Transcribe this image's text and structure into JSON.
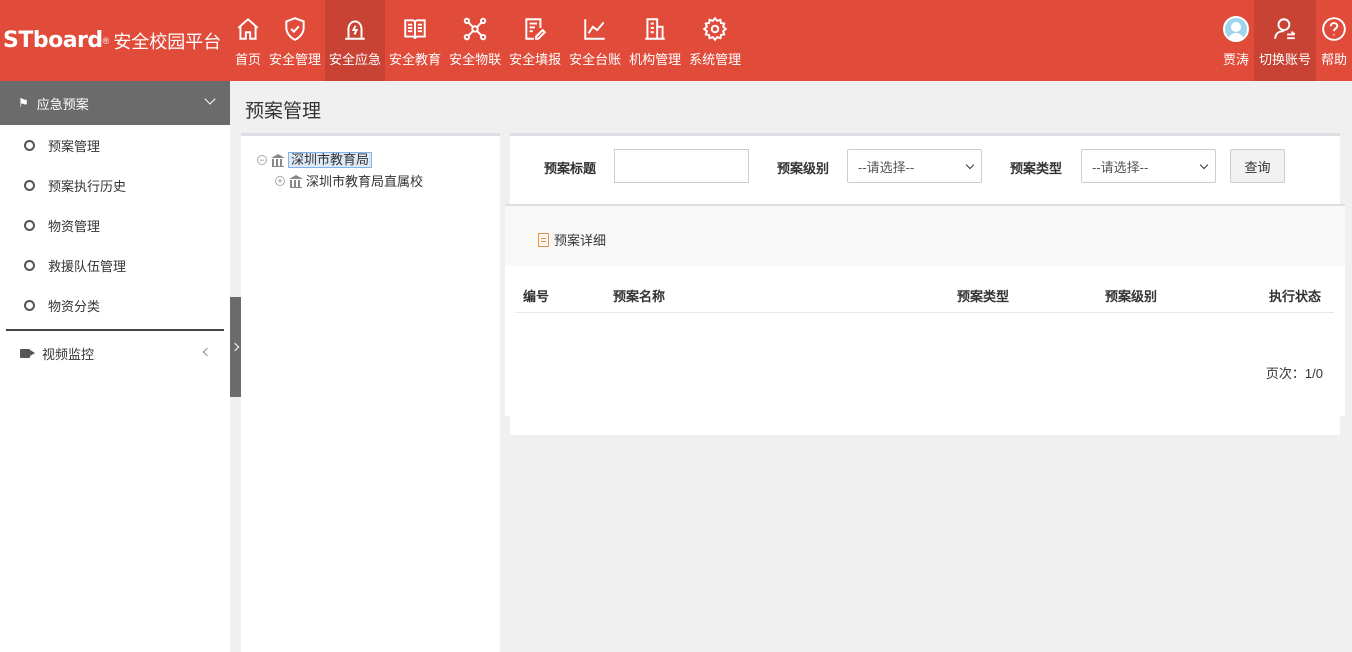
{
  "header": {
    "logo_brand": "STboard",
    "logo_reg": "®",
    "logo_platform": "安全校园平台",
    "nav": [
      {
        "label": "首页",
        "icon": "home-icon"
      },
      {
        "label": "安全管理",
        "icon": "shield-icon"
      },
      {
        "label": "安全应急",
        "icon": "alarm-icon",
        "active": true
      },
      {
        "label": "安全教育",
        "icon": "book-icon"
      },
      {
        "label": "安全物联",
        "icon": "network-icon"
      },
      {
        "label": "安全填报",
        "icon": "edit-icon"
      },
      {
        "label": "安全台账",
        "icon": "chart-icon"
      },
      {
        "label": "机构管理",
        "icon": "building-icon"
      },
      {
        "label": "系统管理",
        "icon": "gear-icon"
      }
    ],
    "user_name": "贾涛",
    "switch_account": "切换账号",
    "help": "帮助"
  },
  "sidebar": {
    "section_title": "应急预案",
    "items": [
      {
        "label": "预案管理"
      },
      {
        "label": "预案执行历史"
      },
      {
        "label": "物资管理"
      },
      {
        "label": "救援队伍管理"
      },
      {
        "label": "物资分类"
      }
    ],
    "video_section": "视频监控"
  },
  "page": {
    "title": "预案管理"
  },
  "tree": {
    "root_toggle": "−",
    "root": "深圳市教育局",
    "child_toggle": "+",
    "child": "深圳市教育局直属校"
  },
  "search": {
    "title_label": "预案标题",
    "title_value": "",
    "level_label": "预案级别",
    "level_selected": "--请选择--",
    "type_label": "预案类型",
    "type_selected": "--请选择--",
    "query_button": "查询"
  },
  "toolbar": {
    "detail_button": "预案详细"
  },
  "table": {
    "columns": [
      "编号",
      "预案名称",
      "预案类型",
      "预案级别",
      "执行状态"
    ],
    "rows": []
  },
  "pager": {
    "text": "页次：1/0"
  },
  "colors": {
    "header_bg": "#e04b3a",
    "header_active": "#c94334",
    "sidebar_head": "#6b6b6b"
  }
}
